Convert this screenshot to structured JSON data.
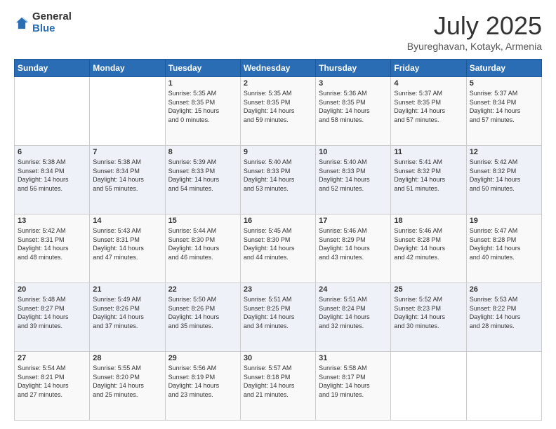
{
  "header": {
    "logo_general": "General",
    "logo_blue": "Blue",
    "month_title": "July 2025",
    "subtitle": "Byureghavan, Kotayk, Armenia"
  },
  "weekdays": [
    "Sunday",
    "Monday",
    "Tuesday",
    "Wednesday",
    "Thursday",
    "Friday",
    "Saturday"
  ],
  "weeks": [
    [
      {
        "day": "",
        "info": ""
      },
      {
        "day": "",
        "info": ""
      },
      {
        "day": "1",
        "info": "Sunrise: 5:35 AM\nSunset: 8:35 PM\nDaylight: 15 hours\nand 0 minutes."
      },
      {
        "day": "2",
        "info": "Sunrise: 5:35 AM\nSunset: 8:35 PM\nDaylight: 14 hours\nand 59 minutes."
      },
      {
        "day": "3",
        "info": "Sunrise: 5:36 AM\nSunset: 8:35 PM\nDaylight: 14 hours\nand 58 minutes."
      },
      {
        "day": "4",
        "info": "Sunrise: 5:37 AM\nSunset: 8:35 PM\nDaylight: 14 hours\nand 57 minutes."
      },
      {
        "day": "5",
        "info": "Sunrise: 5:37 AM\nSunset: 8:34 PM\nDaylight: 14 hours\nand 57 minutes."
      }
    ],
    [
      {
        "day": "6",
        "info": "Sunrise: 5:38 AM\nSunset: 8:34 PM\nDaylight: 14 hours\nand 56 minutes."
      },
      {
        "day": "7",
        "info": "Sunrise: 5:38 AM\nSunset: 8:34 PM\nDaylight: 14 hours\nand 55 minutes."
      },
      {
        "day": "8",
        "info": "Sunrise: 5:39 AM\nSunset: 8:33 PM\nDaylight: 14 hours\nand 54 minutes."
      },
      {
        "day": "9",
        "info": "Sunrise: 5:40 AM\nSunset: 8:33 PM\nDaylight: 14 hours\nand 53 minutes."
      },
      {
        "day": "10",
        "info": "Sunrise: 5:40 AM\nSunset: 8:33 PM\nDaylight: 14 hours\nand 52 minutes."
      },
      {
        "day": "11",
        "info": "Sunrise: 5:41 AM\nSunset: 8:32 PM\nDaylight: 14 hours\nand 51 minutes."
      },
      {
        "day": "12",
        "info": "Sunrise: 5:42 AM\nSunset: 8:32 PM\nDaylight: 14 hours\nand 50 minutes."
      }
    ],
    [
      {
        "day": "13",
        "info": "Sunrise: 5:42 AM\nSunset: 8:31 PM\nDaylight: 14 hours\nand 48 minutes."
      },
      {
        "day": "14",
        "info": "Sunrise: 5:43 AM\nSunset: 8:31 PM\nDaylight: 14 hours\nand 47 minutes."
      },
      {
        "day": "15",
        "info": "Sunrise: 5:44 AM\nSunset: 8:30 PM\nDaylight: 14 hours\nand 46 minutes."
      },
      {
        "day": "16",
        "info": "Sunrise: 5:45 AM\nSunset: 8:30 PM\nDaylight: 14 hours\nand 44 minutes."
      },
      {
        "day": "17",
        "info": "Sunrise: 5:46 AM\nSunset: 8:29 PM\nDaylight: 14 hours\nand 43 minutes."
      },
      {
        "day": "18",
        "info": "Sunrise: 5:46 AM\nSunset: 8:28 PM\nDaylight: 14 hours\nand 42 minutes."
      },
      {
        "day": "19",
        "info": "Sunrise: 5:47 AM\nSunset: 8:28 PM\nDaylight: 14 hours\nand 40 minutes."
      }
    ],
    [
      {
        "day": "20",
        "info": "Sunrise: 5:48 AM\nSunset: 8:27 PM\nDaylight: 14 hours\nand 39 minutes."
      },
      {
        "day": "21",
        "info": "Sunrise: 5:49 AM\nSunset: 8:26 PM\nDaylight: 14 hours\nand 37 minutes."
      },
      {
        "day": "22",
        "info": "Sunrise: 5:50 AM\nSunset: 8:26 PM\nDaylight: 14 hours\nand 35 minutes."
      },
      {
        "day": "23",
        "info": "Sunrise: 5:51 AM\nSunset: 8:25 PM\nDaylight: 14 hours\nand 34 minutes."
      },
      {
        "day": "24",
        "info": "Sunrise: 5:51 AM\nSunset: 8:24 PM\nDaylight: 14 hours\nand 32 minutes."
      },
      {
        "day": "25",
        "info": "Sunrise: 5:52 AM\nSunset: 8:23 PM\nDaylight: 14 hours\nand 30 minutes."
      },
      {
        "day": "26",
        "info": "Sunrise: 5:53 AM\nSunset: 8:22 PM\nDaylight: 14 hours\nand 28 minutes."
      }
    ],
    [
      {
        "day": "27",
        "info": "Sunrise: 5:54 AM\nSunset: 8:21 PM\nDaylight: 14 hours\nand 27 minutes."
      },
      {
        "day": "28",
        "info": "Sunrise: 5:55 AM\nSunset: 8:20 PM\nDaylight: 14 hours\nand 25 minutes."
      },
      {
        "day": "29",
        "info": "Sunrise: 5:56 AM\nSunset: 8:19 PM\nDaylight: 14 hours\nand 23 minutes."
      },
      {
        "day": "30",
        "info": "Sunrise: 5:57 AM\nSunset: 8:18 PM\nDaylight: 14 hours\nand 21 minutes."
      },
      {
        "day": "31",
        "info": "Sunrise: 5:58 AM\nSunset: 8:17 PM\nDaylight: 14 hours\nand 19 minutes."
      },
      {
        "day": "",
        "info": ""
      },
      {
        "day": "",
        "info": ""
      }
    ]
  ]
}
